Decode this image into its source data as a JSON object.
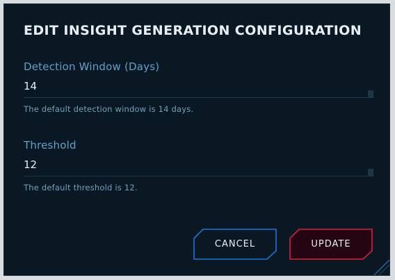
{
  "dialog": {
    "title": "EDIT INSIGHT GENERATION CONFIGURATION"
  },
  "fields": {
    "detection_window": {
      "label": "Detection Window (Days)",
      "value": "14",
      "hint": "The default detection window is 14 days."
    },
    "threshold": {
      "label": "Threshold",
      "value": "12",
      "hint": "The default threshold is 12."
    }
  },
  "buttons": {
    "cancel_label": "CANCEL",
    "update_label": "UPDATE"
  },
  "colors": {
    "background": "#0a1824",
    "label": "#5da3c9",
    "cancel_border": "#1f73d6",
    "update_border": "#d4213f",
    "update_fill": "#260512"
  }
}
